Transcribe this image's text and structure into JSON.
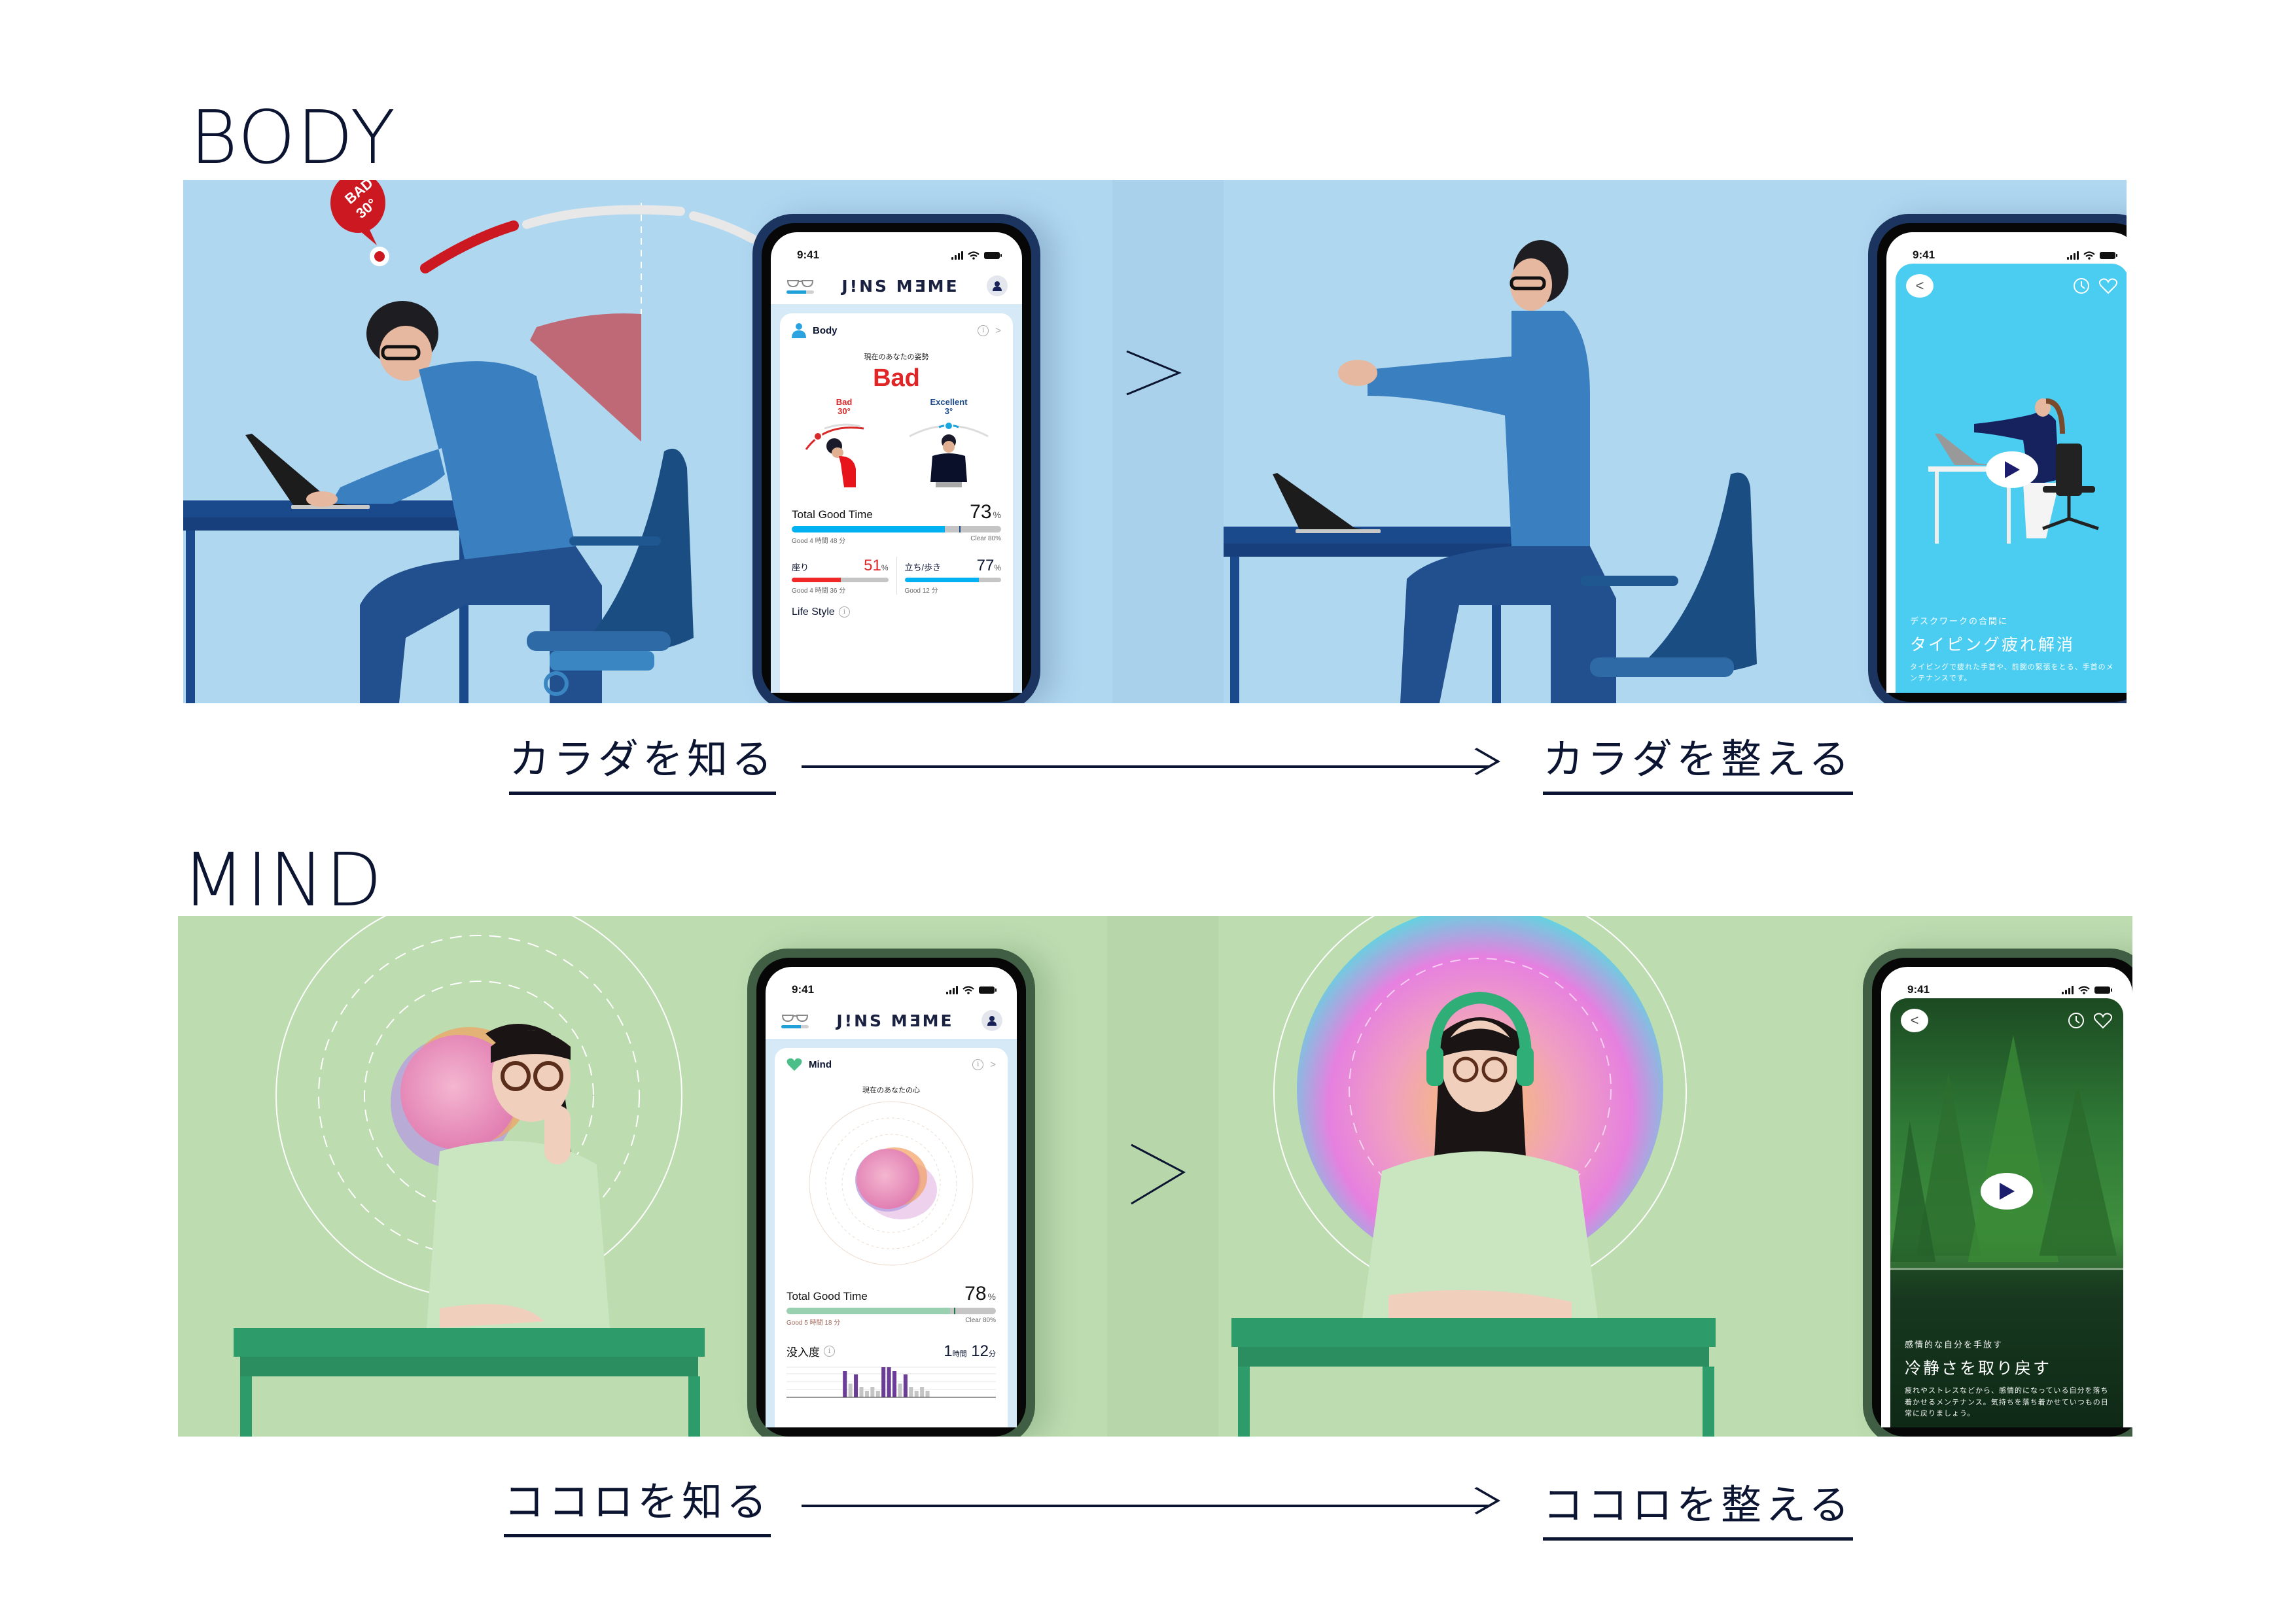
{
  "sections": {
    "body": {
      "heading": "BODY",
      "bg_color": "#b0d7f0",
      "illustration_badge": {
        "label": "BAD",
        "angle": "30°",
        "color": "#cc1820"
      },
      "know_phone": {
        "status_time": "9:41",
        "app_logo": "J!NS MƎME",
        "card_title": "Body",
        "caption": "現在のあなたの姿勢",
        "posture_state": "Bad",
        "postures": [
          {
            "label": "Bad",
            "angle": "30°",
            "color": "#d82a2a"
          },
          {
            "label": "Excellent",
            "angle": "3°",
            "color": "#1b4a8c"
          }
        ],
        "total_good_time": {
          "label": "Total Good Time",
          "value": "73",
          "unit": "%",
          "fill_percent": 73,
          "target_percent": 80,
          "good_time": "Good 4 時間 48 分",
          "clear": "Clear 80%",
          "color": "#00b2f2"
        },
        "sitting": {
          "label": "座り",
          "value": "51",
          "unit": "%",
          "fill_percent": 51,
          "good_time": "Good 4 時間 36 分",
          "color": "#f02828"
        },
        "standing": {
          "label": "立ち/歩き",
          "value": "77",
          "unit": "%",
          "fill_percent": 77,
          "good_time": "Good 12 分",
          "color": "#00b2f2"
        },
        "life_style_label": "Life Style"
      },
      "care_phone": {
        "status_time": "9:41",
        "bg_color": "#4bcdf1",
        "kicker": "デスクワークの合間に",
        "title": "タイピング疲れ解消",
        "description": "タイピングで疲れた手首や、前腕の緊張をとる、手首のメンテナンスです。"
      },
      "know_caption": "カラダを知る",
      "care_caption": "カラダを整える"
    },
    "mind": {
      "heading": "MIND",
      "bg_color": "#bddcb0",
      "know_phone": {
        "status_time": "9:41",
        "app_logo": "J!NS MƎME",
        "card_title": "Mind",
        "caption": "現在のあなたの心",
        "total_good_time": {
          "label": "Total Good Time",
          "value": "78",
          "unit": "%",
          "fill_percent": 78,
          "target_percent": 80,
          "good_time": "Good 5 時間 18 分",
          "clear": "Clear 80%",
          "color": "#98d0b0"
        },
        "immersion": {
          "label": "没入度",
          "hours": "1",
          "hours_unit": "時間",
          "minutes": "12",
          "minutes_unit": "分"
        },
        "immersion_bars": [
          {
            "level": 0,
            "kind": "none"
          },
          {
            "level": 0,
            "kind": "none"
          },
          {
            "level": 0,
            "kind": "none"
          },
          {
            "level": 0,
            "kind": "none"
          },
          {
            "level": 0,
            "kind": "none"
          },
          {
            "level": 0,
            "kind": "none"
          },
          {
            "level": 0,
            "kind": "none"
          },
          {
            "level": 0,
            "kind": "none"
          },
          {
            "level": 0,
            "kind": "none"
          },
          {
            "level": 0,
            "kind": "none"
          },
          {
            "level": 0.8,
            "kind": "high"
          },
          {
            "level": 0.42,
            "kind": "low"
          },
          {
            "level": 0.7,
            "kind": "high"
          },
          {
            "level": 0.32,
            "kind": "low"
          },
          {
            "level": 0.2,
            "kind": "low"
          },
          {
            "level": 0.32,
            "kind": "low"
          },
          {
            "level": 0.2,
            "kind": "low"
          },
          {
            "level": 0.92,
            "kind": "high"
          },
          {
            "level": 0.92,
            "kind": "high"
          },
          {
            "level": 0.8,
            "kind": "high"
          },
          {
            "level": 0.42,
            "kind": "low"
          },
          {
            "level": 0.7,
            "kind": "high"
          },
          {
            "level": 0.32,
            "kind": "low"
          },
          {
            "level": 0.2,
            "kind": "low"
          },
          {
            "level": 0.32,
            "kind": "low"
          },
          {
            "level": 0.2,
            "kind": "low"
          }
        ]
      },
      "care_phone": {
        "status_time": "9:41",
        "kicker": "感情的な自分を手放す",
        "title": "冷静さを取り戻す",
        "description": "疲れやストレスなどから、感情的になっている自分を落ち着かせるメンテナンス。気持ちを落ち着かせていつもの日常に戻りましょう。"
      },
      "know_caption": "ココロを知る",
      "care_caption": "ココロを整える"
    }
  },
  "icons": {
    "chevron": "chevron-right-icon",
    "back": "back-icon",
    "history": "clock-icon",
    "favorite": "heart-icon",
    "play": "play-icon",
    "profile": "user-icon",
    "device": "glasses-icon",
    "info": "info-icon"
  },
  "colors": {
    "ink": "#0b1430",
    "play_triangle": "#1d1d6e",
    "immersion_high": "#6b3d96",
    "immersion_low": "#c5c5c5"
  }
}
